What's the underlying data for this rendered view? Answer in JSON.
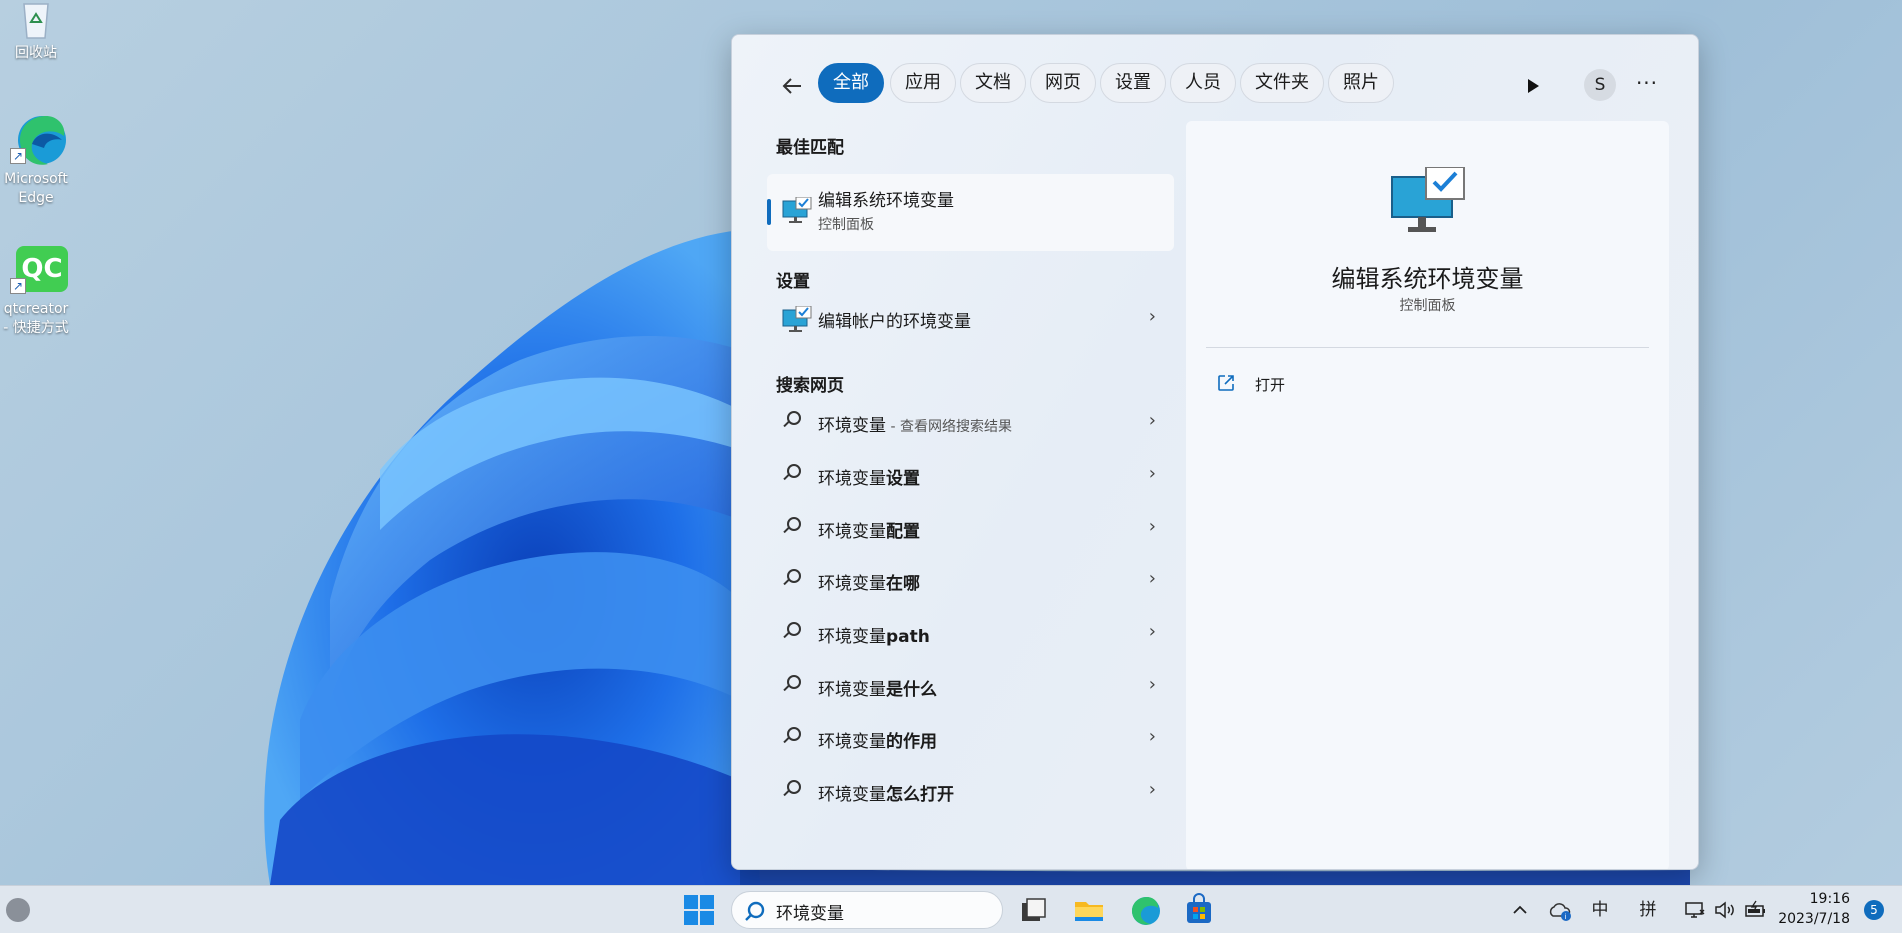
{
  "desktop": {
    "icons": [
      {
        "label": "回收站",
        "icon": "recycle-bin-icon"
      },
      {
        "label": "Microsoft\nEdge",
        "icon": "edge-icon"
      },
      {
        "label": "qtcreator - 快捷方式",
        "icon": "qtcreator-icon"
      }
    ]
  },
  "search_panel": {
    "filters": [
      "全部",
      "应用",
      "文档",
      "网页",
      "设置",
      "人员",
      "文件夹",
      "照片"
    ],
    "active_filter": "全部",
    "avatar_letter": "S",
    "best_match": {
      "section": "最佳匹配",
      "title": "编辑系统环境变量",
      "subtitle": "控制面板"
    },
    "settings": {
      "section": "设置",
      "items": [
        {
          "title": "编辑帐户的环境变量"
        }
      ]
    },
    "web": {
      "section": "搜索网页",
      "items": [
        {
          "prefix": "环境变量",
          "bold": "",
          "note": " - 查看网络搜索结果"
        },
        {
          "prefix": "环境变量",
          "bold": "设置",
          "note": ""
        },
        {
          "prefix": "环境变量",
          "bold": "配置",
          "note": ""
        },
        {
          "prefix": "环境变量",
          "bold": "在哪",
          "note": ""
        },
        {
          "prefix": "环境变量",
          "bold": "path",
          "note": ""
        },
        {
          "prefix": "环境变量",
          "bold": "是什么",
          "note": ""
        },
        {
          "prefix": "环境变量",
          "bold": "的作用",
          "note": ""
        },
        {
          "prefix": "环境变量",
          "bold": "怎么打开",
          "note": ""
        }
      ]
    },
    "detail": {
      "title": "编辑系统环境变量",
      "subtitle": "控制面板",
      "actions": [
        {
          "label": "打开",
          "icon": "open-external-icon"
        }
      ]
    }
  },
  "taskbar": {
    "search_value": "环境变量",
    "apps": [
      "task-view-icon",
      "file-explorer-icon",
      "edge-icon",
      "store-icon"
    ],
    "tray": {
      "ime_mode": "中",
      "ime_input": "拼"
    },
    "clock": {
      "time": "19:16",
      "date": "2023/7/18"
    },
    "notification_count": "5"
  },
  "colors": {
    "accent": "#0f6cbd",
    "panel_bg": "#e9eef6",
    "taskbar_bg": "#dfe6ee"
  }
}
